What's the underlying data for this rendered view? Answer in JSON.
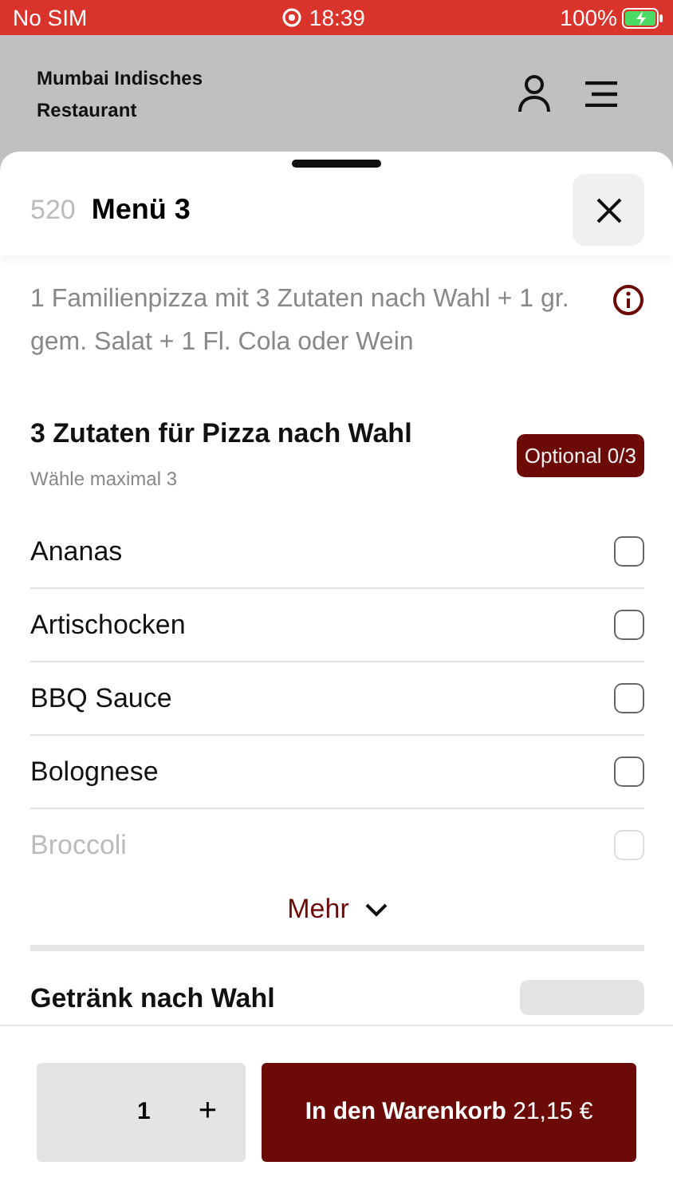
{
  "status_bar": {
    "carrier": "No SIM",
    "time": "18:39",
    "battery": "100%"
  },
  "header": {
    "title": "Mumbai Indisches Restaurant"
  },
  "sheet": {
    "number": "520",
    "title": "Menü 3",
    "description": "1 Familienpizza mit 3 Zutaten nach Wahl + 1 gr. gem. Salat + 1 Fl. Cola oder Wein"
  },
  "groups": [
    {
      "title": "3 Zutaten für Pizza nach Wahl",
      "hint": "Wähle maximal 3",
      "badge": "Optional 0/3",
      "kind": "optional",
      "options": [
        {
          "label": "Ananas",
          "checked": false,
          "faded": false
        },
        {
          "label": "Artischocken",
          "checked": false,
          "faded": false
        },
        {
          "label": "BBQ Sauce",
          "checked": false,
          "faded": false
        },
        {
          "label": "Bolognese",
          "checked": false,
          "faded": false
        },
        {
          "label": "Broccoli",
          "checked": false,
          "faded": true
        }
      ],
      "more": "Mehr"
    },
    {
      "title": "Getränk nach Wahl",
      "kind": "required"
    }
  ],
  "footer": {
    "quantity": "1",
    "plus": "+",
    "cart_label": "In den Warenkorb",
    "price": "21,15 €"
  }
}
